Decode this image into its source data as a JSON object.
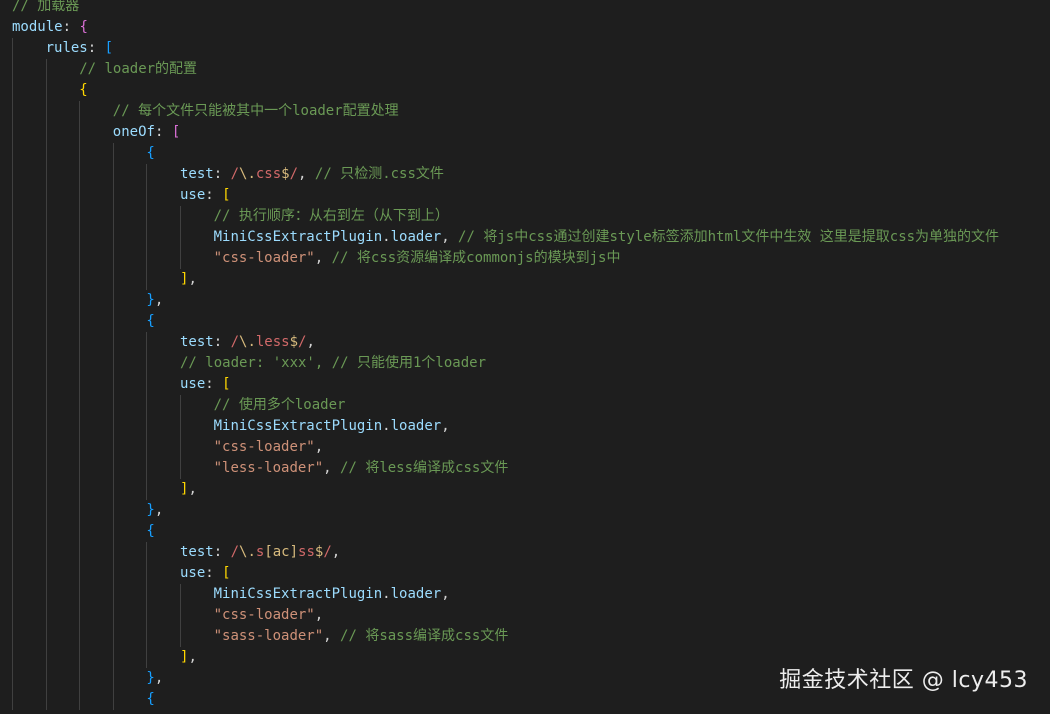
{
  "theme": {
    "background": "#1e1e1e",
    "comment": "#6a9955",
    "property": "#9cdcfe",
    "string": "#ce9178",
    "regex": "#d16969",
    "bracket_colors": [
      "#ffd700",
      "#da70d6",
      "#179fff"
    ]
  },
  "watermark": "掘金技术社区 @ lcy453",
  "lines": [
    {
      "indent": 0,
      "tokens": [
        {
          "t": "// 加载器",
          "c": "comment"
        }
      ]
    },
    {
      "indent": 0,
      "tokens": [
        {
          "t": "module",
          "c": "property"
        },
        {
          "t": ": ",
          "c": "plain"
        },
        {
          "t": "{",
          "c": "bracket-2"
        }
      ]
    },
    {
      "indent": 1,
      "tokens": [
        {
          "t": "rules",
          "c": "property"
        },
        {
          "t": ": ",
          "c": "plain"
        },
        {
          "t": "[",
          "c": "bracket-3"
        }
      ]
    },
    {
      "indent": 2,
      "tokens": [
        {
          "t": "// loader的配置",
          "c": "comment"
        }
      ]
    },
    {
      "indent": 2,
      "tokens": [
        {
          "t": "{",
          "c": "bracket-1"
        }
      ]
    },
    {
      "indent": 3,
      "tokens": [
        {
          "t": "// 每个文件只能被其中一个loader配置处理",
          "c": "comment"
        }
      ]
    },
    {
      "indent": 3,
      "tokens": [
        {
          "t": "oneOf",
          "c": "property"
        },
        {
          "t": ": ",
          "c": "plain"
        },
        {
          "t": "[",
          "c": "bracket-2"
        }
      ]
    },
    {
      "indent": 4,
      "tokens": [
        {
          "t": "{",
          "c": "bracket-3"
        }
      ]
    },
    {
      "indent": 5,
      "tokens": [
        {
          "t": "test",
          "c": "property"
        },
        {
          "t": ": ",
          "c": "plain"
        },
        {
          "t": "/",
          "c": "regex"
        },
        {
          "t": "\\.",
          "c": "regex-escape"
        },
        {
          "t": "css",
          "c": "regex"
        },
        {
          "t": "$",
          "c": "regex-escape"
        },
        {
          "t": "/",
          "c": "regex"
        },
        {
          "t": ", ",
          "c": "plain"
        },
        {
          "t": "// 只检测.css文件",
          "c": "comment"
        }
      ]
    },
    {
      "indent": 5,
      "tokens": [
        {
          "t": "use",
          "c": "property"
        },
        {
          "t": ": ",
          "c": "plain"
        },
        {
          "t": "[",
          "c": "bracket-1"
        }
      ]
    },
    {
      "indent": 6,
      "tokens": [
        {
          "t": "// 执行顺序：从右到左（从下到上）",
          "c": "comment"
        }
      ]
    },
    {
      "indent": 6,
      "tokens": [
        {
          "t": "MiniCssExtractPlugin",
          "c": "property"
        },
        {
          "t": ".",
          "c": "plain"
        },
        {
          "t": "loader",
          "c": "property"
        },
        {
          "t": ", ",
          "c": "plain"
        },
        {
          "t": "// 将js中css通过创建style标签添加html文件中生效 这里是提取css为单独的文件",
          "c": "comment"
        }
      ]
    },
    {
      "indent": 6,
      "tokens": [
        {
          "t": "\"css-loader\"",
          "c": "string"
        },
        {
          "t": ", ",
          "c": "plain"
        },
        {
          "t": "// 将css资源编译成commonjs的模块到js中",
          "c": "comment"
        }
      ]
    },
    {
      "indent": 5,
      "tokens": [
        {
          "t": "]",
          "c": "bracket-1"
        },
        {
          "t": ",",
          "c": "plain"
        }
      ]
    },
    {
      "indent": 4,
      "tokens": [
        {
          "t": "}",
          "c": "bracket-3"
        },
        {
          "t": ",",
          "c": "plain"
        }
      ]
    },
    {
      "indent": 4,
      "tokens": [
        {
          "t": "{",
          "c": "bracket-3"
        }
      ]
    },
    {
      "indent": 5,
      "tokens": [
        {
          "t": "test",
          "c": "property"
        },
        {
          "t": ": ",
          "c": "plain"
        },
        {
          "t": "/",
          "c": "regex"
        },
        {
          "t": "\\.",
          "c": "regex-escape"
        },
        {
          "t": "less",
          "c": "regex"
        },
        {
          "t": "$",
          "c": "regex-escape"
        },
        {
          "t": "/",
          "c": "regex"
        },
        {
          "t": ",",
          "c": "plain"
        }
      ]
    },
    {
      "indent": 5,
      "tokens": [
        {
          "t": "// loader: 'xxx', // 只能使用1个loader",
          "c": "comment"
        }
      ]
    },
    {
      "indent": 5,
      "tokens": [
        {
          "t": "use",
          "c": "property"
        },
        {
          "t": ": ",
          "c": "plain"
        },
        {
          "t": "[",
          "c": "bracket-1"
        }
      ]
    },
    {
      "indent": 6,
      "tokens": [
        {
          "t": "// 使用多个loader",
          "c": "comment"
        }
      ]
    },
    {
      "indent": 6,
      "tokens": [
        {
          "t": "MiniCssExtractPlugin",
          "c": "property"
        },
        {
          "t": ".",
          "c": "plain"
        },
        {
          "t": "loader",
          "c": "property"
        },
        {
          "t": ",",
          "c": "plain"
        }
      ]
    },
    {
      "indent": 6,
      "tokens": [
        {
          "t": "\"css-loader\"",
          "c": "string"
        },
        {
          "t": ",",
          "c": "plain"
        }
      ]
    },
    {
      "indent": 6,
      "tokens": [
        {
          "t": "\"less-loader\"",
          "c": "string"
        },
        {
          "t": ", ",
          "c": "plain"
        },
        {
          "t": "// 将less编译成css文件",
          "c": "comment"
        }
      ]
    },
    {
      "indent": 5,
      "tokens": [
        {
          "t": "]",
          "c": "bracket-1"
        },
        {
          "t": ",",
          "c": "plain"
        }
      ]
    },
    {
      "indent": 4,
      "tokens": [
        {
          "t": "}",
          "c": "bracket-3"
        },
        {
          "t": ",",
          "c": "plain"
        }
      ]
    },
    {
      "indent": 4,
      "tokens": [
        {
          "t": "{",
          "c": "bracket-3"
        }
      ]
    },
    {
      "indent": 5,
      "tokens": [
        {
          "t": "test",
          "c": "property"
        },
        {
          "t": ": ",
          "c": "plain"
        },
        {
          "t": "/",
          "c": "regex"
        },
        {
          "t": "\\.",
          "c": "regex-escape"
        },
        {
          "t": "s",
          "c": "regex"
        },
        {
          "t": "[ac]",
          "c": "regex-escape"
        },
        {
          "t": "ss",
          "c": "regex"
        },
        {
          "t": "$",
          "c": "regex-escape"
        },
        {
          "t": "/",
          "c": "regex"
        },
        {
          "t": ",",
          "c": "plain"
        }
      ]
    },
    {
      "indent": 5,
      "tokens": [
        {
          "t": "use",
          "c": "property"
        },
        {
          "t": ": ",
          "c": "plain"
        },
        {
          "t": "[",
          "c": "bracket-1"
        }
      ]
    },
    {
      "indent": 6,
      "tokens": [
        {
          "t": "MiniCssExtractPlugin",
          "c": "property"
        },
        {
          "t": ".",
          "c": "plain"
        },
        {
          "t": "loader",
          "c": "property"
        },
        {
          "t": ",",
          "c": "plain"
        }
      ]
    },
    {
      "indent": 6,
      "tokens": [
        {
          "t": "\"css-loader\"",
          "c": "string"
        },
        {
          "t": ",",
          "c": "plain"
        }
      ]
    },
    {
      "indent": 6,
      "tokens": [
        {
          "t": "\"sass-loader\"",
          "c": "string"
        },
        {
          "t": ", ",
          "c": "plain"
        },
        {
          "t": "// 将sass编译成css文件",
          "c": "comment"
        }
      ]
    },
    {
      "indent": 5,
      "tokens": [
        {
          "t": "]",
          "c": "bracket-1"
        },
        {
          "t": ",",
          "c": "plain"
        }
      ]
    },
    {
      "indent": 4,
      "tokens": [
        {
          "t": "}",
          "c": "bracket-3"
        },
        {
          "t": ",",
          "c": "plain"
        }
      ]
    },
    {
      "indent": 4,
      "tokens": [
        {
          "t": "{",
          "c": "bracket-3"
        }
      ]
    }
  ]
}
